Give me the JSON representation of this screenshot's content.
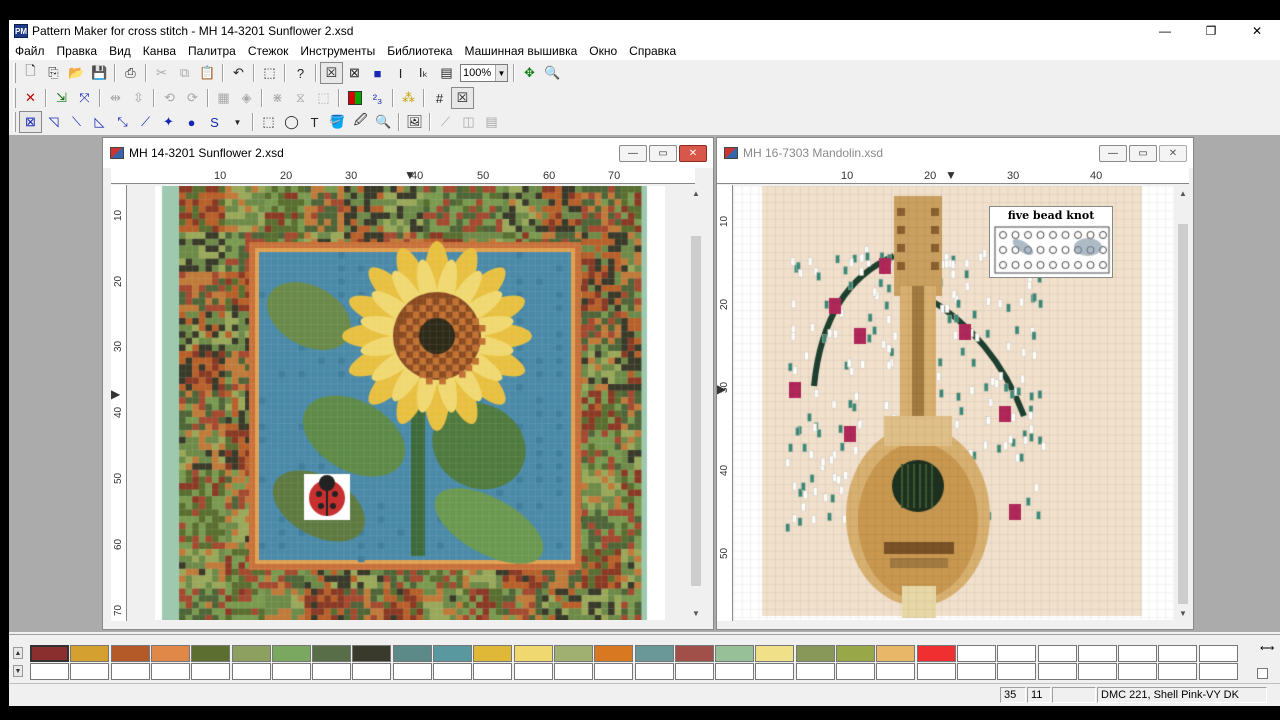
{
  "window": {
    "title": "Pattern Maker for cross stitch - MH 14-3201 Sunflower 2.xsd",
    "minimize": "—",
    "restore": "❐",
    "close": "✕"
  },
  "menu": [
    "Файл",
    "Правка",
    "Вид",
    "Канва",
    "Палитра",
    "Стежок",
    "Инструменты",
    "Библиотека",
    "Машинная вышивка",
    "Окно",
    "Справка"
  ],
  "toolbar": {
    "zoom_value": "100%"
  },
  "doc1": {
    "title": "MH 14-3201 Sunflower 2.xsd",
    "ruler_x": [
      "10",
      "20",
      "30",
      "40",
      "50",
      "60",
      "70"
    ],
    "ruler_y": [
      "10",
      "20",
      "30",
      "40",
      "50",
      "60",
      "70"
    ]
  },
  "doc2": {
    "title": "MH 16-7303 Mandolin.xsd",
    "ruler_x": [
      "10",
      "20",
      "30",
      "40"
    ],
    "ruler_y": [
      "10",
      "20",
      "30",
      "40",
      "50"
    ],
    "legend_title": "five bead knot"
  },
  "palette": {
    "colors": [
      "#8b2e2e",
      "#d4a030",
      "#b35a28",
      "#e08848",
      "#5c6e30",
      "#8ea060",
      "#7aa860",
      "#586e48",
      "#3a3a2c",
      "#5c8a88",
      "#5a98a0",
      "#e0b838",
      "#f0d870",
      "#a0b070",
      "#d87820",
      "#6a9898",
      "#a05048",
      "#98c098",
      "#f0e088",
      "#889858",
      "#98a848",
      "#e8b868",
      "#f03030"
    ],
    "blank_count": 7
  },
  "status": {
    "x": "35",
    "y": "11",
    "empty": "",
    "color_name": "DMC  221, Shell Pink-VY DK"
  }
}
